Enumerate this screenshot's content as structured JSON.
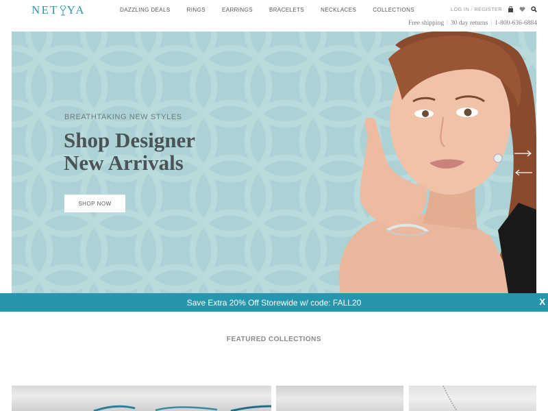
{
  "brand": {
    "logo_text_left": "NET",
    "logo_text_right": "YA",
    "logo_accent_color": "#2a9aa8"
  },
  "nav": {
    "items": [
      {
        "label": "DAZZLING DEALS"
      },
      {
        "label": "RINGS"
      },
      {
        "label": "EARRINGS"
      },
      {
        "label": "BRACELETS"
      },
      {
        "label": "NECKLACES"
      },
      {
        "label": "COLLECTIONS"
      }
    ]
  },
  "utility": {
    "login": "LOG IN",
    "separator": "/",
    "register": "REGISTER",
    "icons": [
      "bag-icon",
      "heart-icon",
      "search-icon"
    ]
  },
  "infobar": {
    "shipping": "Free shipping",
    "returns": "30 day returns",
    "phone": "1-800-636-6884",
    "separator": "|"
  },
  "hero": {
    "eyebrow": "BREATHTAKING NEW STYLES",
    "title_line1": "Shop Designer",
    "title_line2": "New Arrivals",
    "button_label": "SHOP NOW",
    "background_color": "#acd2d5"
  },
  "promo": {
    "text": "Save Extra 20% Off Storewide w/ code: FALL20",
    "close_label": "X",
    "background_color": "#2596ac"
  },
  "featured": {
    "title": "FEATURED COLLECTIONS"
  }
}
